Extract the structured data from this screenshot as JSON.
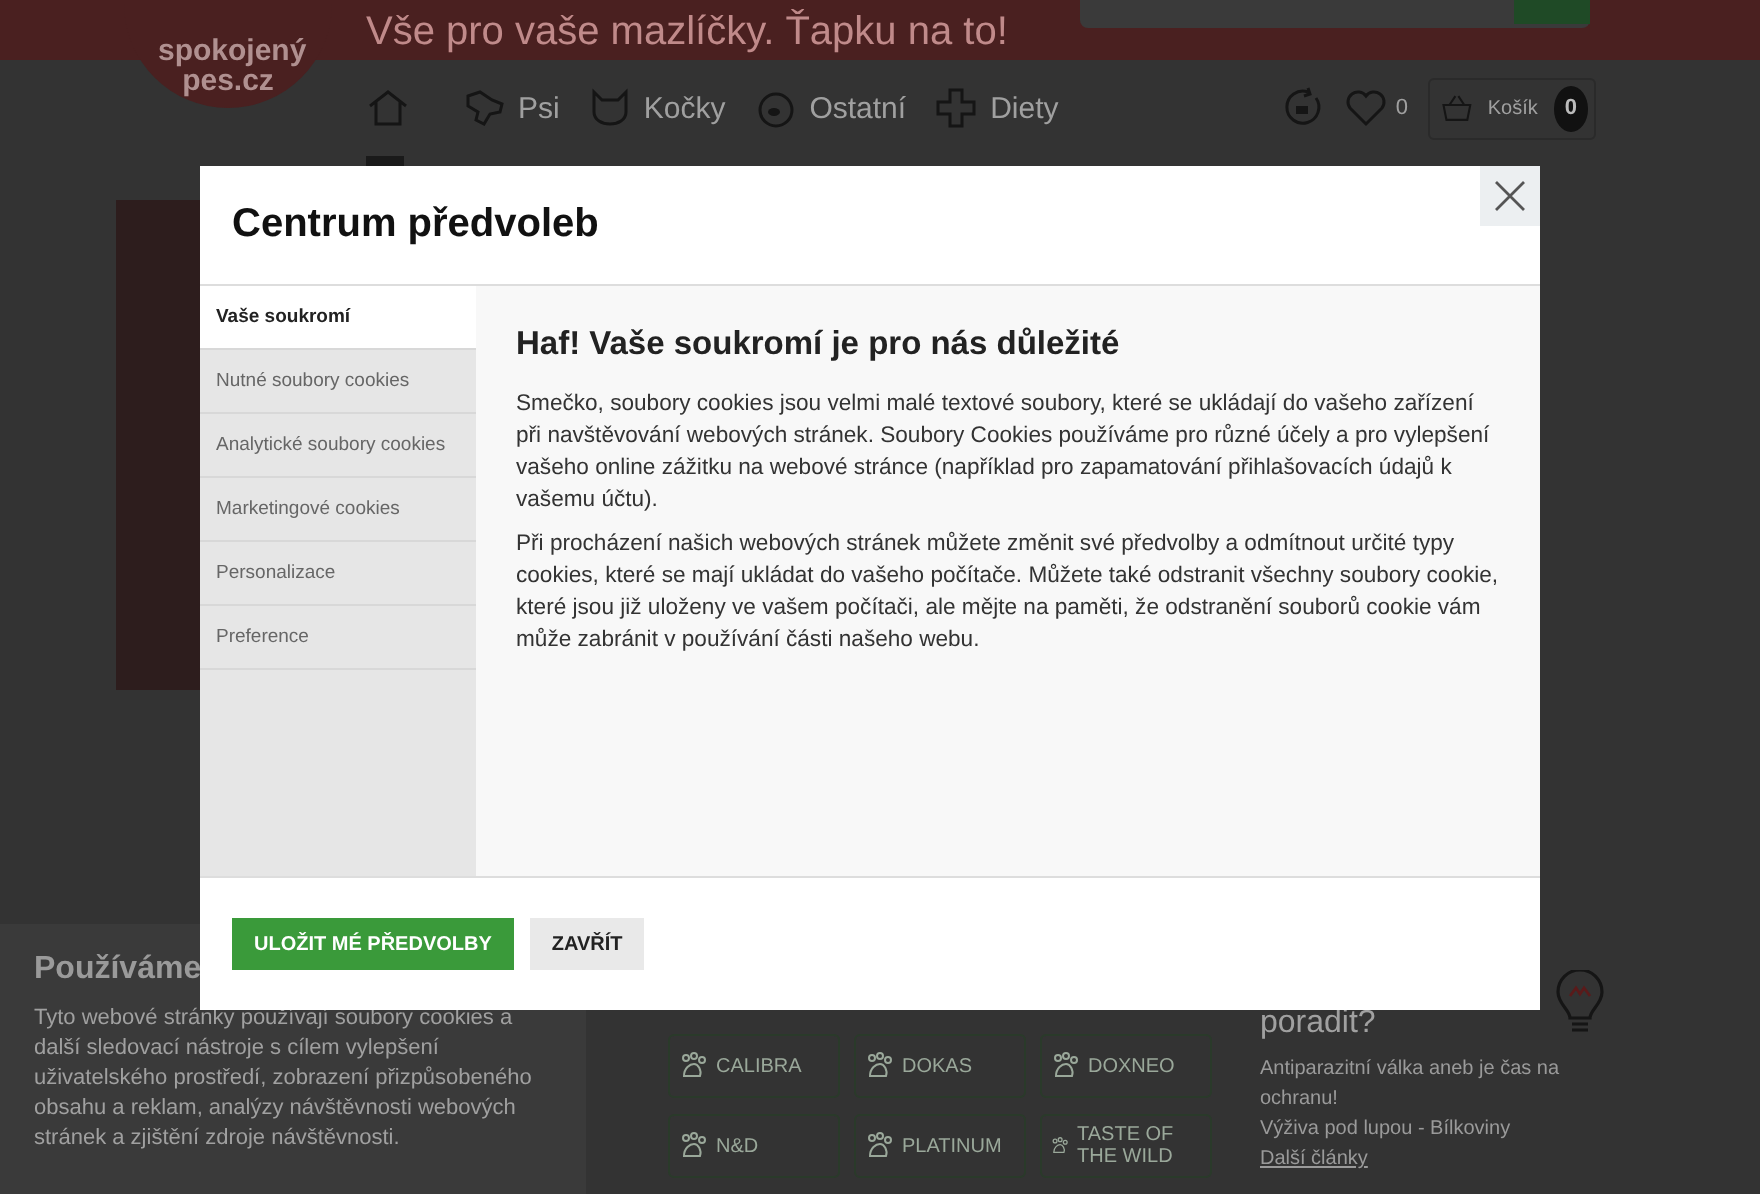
{
  "header": {
    "logo": "spokojený pes.cz",
    "tagline": "Vše pro vaše mazlíčky. Ťapku na to!"
  },
  "nav": {
    "items": [
      {
        "label": "Psi",
        "kind": "dog"
      },
      {
        "label": "Kočky",
        "kind": "cat"
      },
      {
        "label": "Ostatní",
        "kind": "fish"
      },
      {
        "label": "Diety",
        "kind": "plus"
      }
    ],
    "favorites_count": "0",
    "cart": {
      "label": "Košík",
      "count": "0"
    }
  },
  "brands": [
    {
      "label": "CALIBRA"
    },
    {
      "label": "DOKAS"
    },
    {
      "label": "DOXNEO"
    },
    {
      "label": "N&D"
    },
    {
      "label": "PLATINUM"
    },
    {
      "label": "TASTE OF THE WILD"
    }
  ],
  "advice": {
    "title": "poradit?",
    "articles": [
      "Antiparazitní válka aneb je čas na ochranu!",
      "Výživa pod lupou - Bílkoviny"
    ],
    "more": "Další články"
  },
  "cookie_banner": {
    "title": "Používáme",
    "text": "Tyto webové stránky používají soubory cookies a další sledovací nástroje s cílem vylepšení uživatelského prostředí, zobrazení přizpůsobeného obsahu a reklam, analýzy návštěvnosti webových stránek a zjištění zdroje návštěvnosti."
  },
  "modal": {
    "title": "Centrum předvoleb",
    "tabs": [
      {
        "label": "Vaše soukromí",
        "selected": true
      },
      {
        "label": "Nutné soubory cookies",
        "selected": false
      },
      {
        "label": "Analytické soubory cookies",
        "selected": false
      },
      {
        "label": "Marketingové cookies",
        "selected": false
      },
      {
        "label": "Personalizace",
        "selected": false
      },
      {
        "label": "Preference",
        "selected": false
      }
    ],
    "heading": "Haf! Vaše soukromí je pro nás důležité",
    "paragraphs": [
      "Smečko, soubory cookies jsou velmi malé textové soubory, které se ukládají do vašeho zařízení při navštěvování webových stránek. Soubory Cookies používáme pro různé účely a pro vylepšení vašeho online zážitku na webové stránce (například pro zapamatování přihlašovacích údajů k vašemu účtu).",
      "Při procházení našich webových stránek můžete změnit své předvolby a odmítnout určité typy cookies, které se mají ukládat do vašeho počítače. Můžete také odstranit všechny soubory cookie, které jsou již uloženy ve vašem počítači, ale mějte na paměti, že odstranění souborů cookie vám může zabránit v používání části našeho webu."
    ],
    "buttons": [
      {
        "label": "ULOŽIT MÉ PŘEDVOLBY",
        "kind": "primary"
      },
      {
        "label": "ZAVŘÍT",
        "kind": "secondary"
      }
    ]
  }
}
